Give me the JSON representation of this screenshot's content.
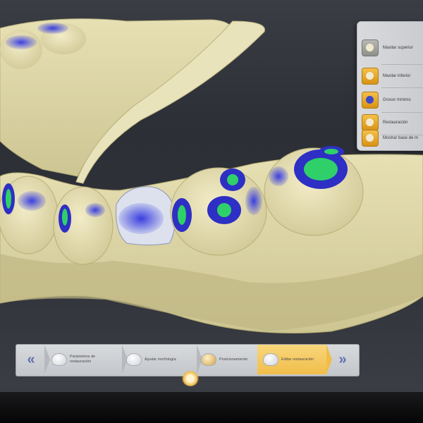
{
  "side_panel": {
    "items": [
      {
        "label": "Maxilar superior",
        "icon": "upper-jaw-icon"
      },
      {
        "label": "Maxilar inferior",
        "icon": "lower-jaw-icon"
      },
      {
        "label": "Grosor mínimo",
        "icon": "min-thickness-icon"
      },
      {
        "label": "Restauración",
        "icon": "restoration-icon"
      },
      {
        "label": "Mostrar base de m",
        "icon": "model-base-icon"
      }
    ]
  },
  "workflow": {
    "back_icon": "«",
    "next_icon": "»",
    "steps": [
      {
        "label": "Parámetros de restauración",
        "icon": "tooth-icon"
      },
      {
        "label": "Ajustar morfología",
        "icon": "tooth-morphology-icon"
      },
      {
        "label": "Posicionamiento",
        "icon": "positioning-icon"
      },
      {
        "label": "Editar restauración",
        "icon": "edit-restoration-icon"
      }
    ],
    "active_step": 3
  },
  "colors": {
    "model": "#ddd6a6",
    "contact_blue": "#2e2fc4",
    "contact_green": "#2fd06a",
    "accent_gold": "#f0bd4a"
  }
}
